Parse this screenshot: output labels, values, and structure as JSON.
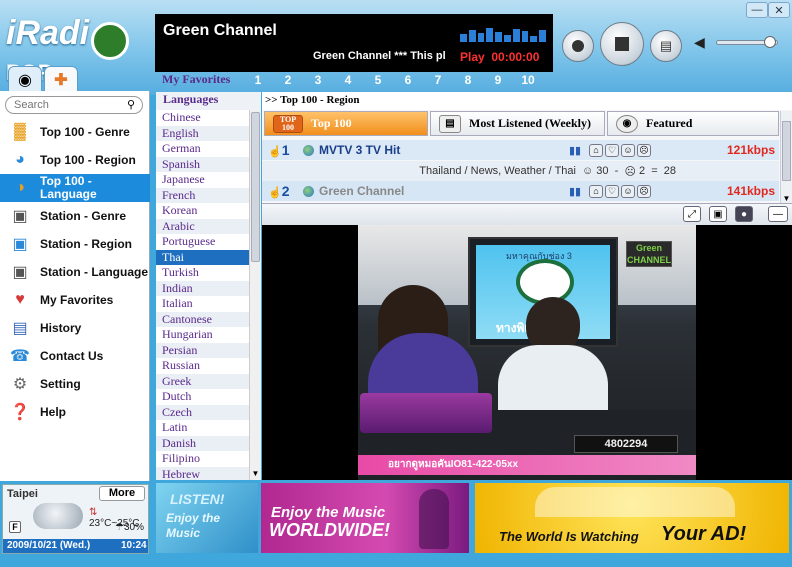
{
  "app": {
    "logo_main": "iRadi",
    "logo_tail": "POP"
  },
  "player": {
    "station": "Green Channel",
    "ticker": "Green Channel *** This pl",
    "status": "Play",
    "time": "00:00:00",
    "favorites_label": "My Favorites",
    "favorites": [
      "1",
      "2",
      "3",
      "4",
      "5",
      "6",
      "7",
      "8",
      "9",
      "10"
    ]
  },
  "search": {
    "placeholder": "Search"
  },
  "nav": [
    {
      "label": "Top 100 - Genre",
      "icon": "chart-icon"
    },
    {
      "label": "Top 100 - Region",
      "icon": "globe-chart-icon"
    },
    {
      "label": "Top 100 - Language",
      "icon": "language-chart-icon",
      "active": true
    },
    {
      "label": "Station - Genre",
      "icon": "station-genre-icon"
    },
    {
      "label": "Station - Region",
      "icon": "station-region-icon"
    },
    {
      "label": "Station - Language",
      "icon": "station-language-icon"
    },
    {
      "label": "My Favorites",
      "icon": "heart-icon"
    },
    {
      "label": "History",
      "icon": "history-icon"
    },
    {
      "label": "Contact Us",
      "icon": "phone-icon"
    },
    {
      "label": "Setting",
      "icon": "gear-icon"
    },
    {
      "label": "Help",
      "icon": "help-icon"
    }
  ],
  "weather": {
    "city": "Taipei",
    "more": "More",
    "temp": "23°C~25°C",
    "humidity": "30%",
    "unit": "F",
    "date": "2009/10/21 (Wed.)",
    "time": "10:24"
  },
  "languages_header": "Languages",
  "languages": [
    "Chinese",
    "English",
    "German",
    "Spanish",
    "Japanese",
    "French",
    "Korean",
    "Arabic",
    "Portuguese",
    "Thai",
    "Turkish",
    "Indian",
    "Italian",
    "Cantonese",
    "Hungarian",
    "Persian",
    "Russian",
    "Greek",
    "Dutch",
    "Czech",
    "Latin",
    "Danish",
    "Filipino",
    "Hebrew"
  ],
  "selected_language": "Thai",
  "breadcrumb": ">> Top 100 - Region",
  "tabs": {
    "top100": "Top 100",
    "top100_badge": "TOP 100",
    "weekly": "Most Listened (Weekly)",
    "featured": "Featured"
  },
  "stations": [
    {
      "rank": "1",
      "name": "MVTV 3 TV Hit",
      "kbps": "121kbps"
    },
    {
      "rank": "2",
      "name": "Green Channel",
      "kbps": "141kbps"
    }
  ],
  "station_detail": {
    "info": "Thailand / News, Weather / Thai",
    "likes": "30",
    "dislikes": "2",
    "score": "28"
  },
  "video": {
    "caption": "อยากดูหมอคันIO81-422-05xx",
    "number": "4802294",
    "channel_logo": "Green CHANNEL",
    "studio_sign": "มหาคุณกับช่อง 3",
    "program": "ทางพิเศษ"
  },
  "ads": {
    "ad1_line1": "LISTEN!",
    "ad1_line2": "Enjoy the Music",
    "ad2_line1": "Enjoy the Music",
    "ad2_line2": "WORLDWIDE!",
    "ad3_text": "The World Is Watching",
    "ad3_big": "Your AD!"
  },
  "colors": {
    "accent": "#1c8bdc",
    "play_red": "#ff3030",
    "purple": "#5a2a8a",
    "tab_orange": "#f7a23a"
  }
}
